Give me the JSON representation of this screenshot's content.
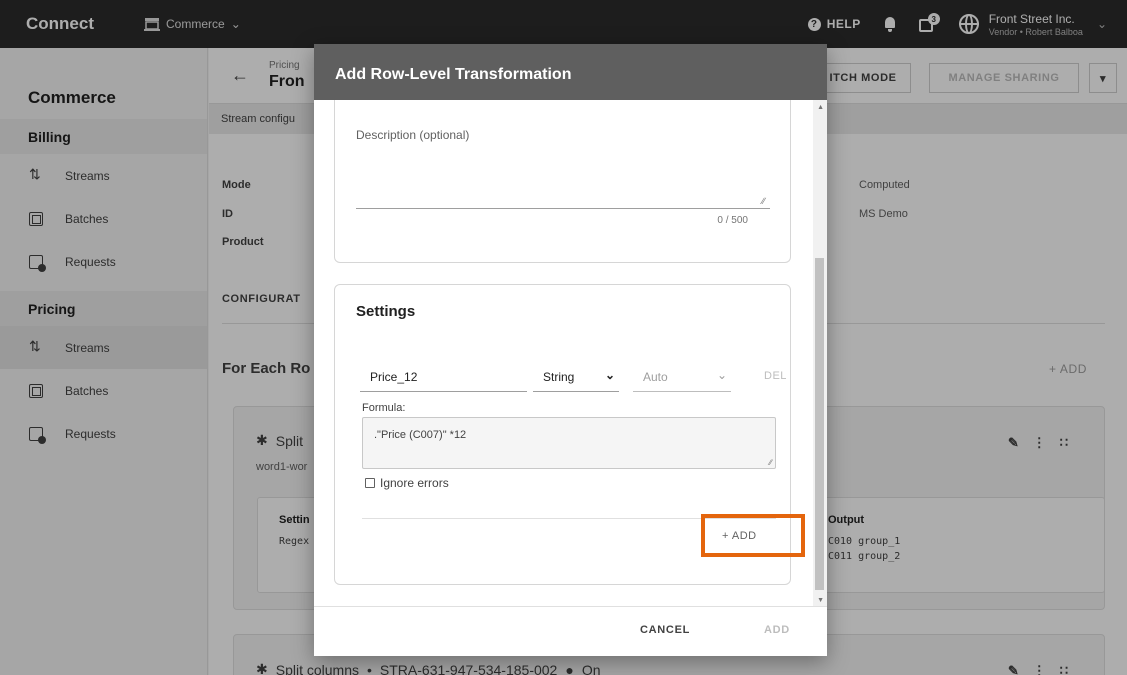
{
  "topbar": {
    "brand": "Connect",
    "module": "Commerce",
    "help": "HELP",
    "notif_count": "3",
    "account_name": "Front Street Inc.",
    "account_sub": "Vendor • Robert Balboa"
  },
  "sidebar": {
    "title": "Commerce",
    "sections": [
      {
        "label": "Billing",
        "items": [
          {
            "label": "Streams",
            "icon": "streams-icon"
          },
          {
            "label": "Batches",
            "icon": "batches-icon"
          },
          {
            "label": "Requests",
            "icon": "requests-icon"
          }
        ]
      },
      {
        "label": "Pricing",
        "items": [
          {
            "label": "Streams",
            "icon": "streams-icon",
            "active": true
          },
          {
            "label": "Batches",
            "icon": "batches-icon"
          },
          {
            "label": "Requests",
            "icon": "requests-icon"
          }
        ]
      }
    ]
  },
  "main": {
    "crumb_small": "Pricing",
    "crumb_big": "Fron",
    "switch_mode": "ITCH MODE",
    "manage_sharing": "MANAGE SHARING",
    "stream_config": "Stream configu",
    "fields": {
      "mode_k": "Mode",
      "id_k": "ID",
      "product_k": "Product",
      "mode_v": "Computed",
      "id_v": "MS Demo"
    },
    "configuration": "CONFIGURAT",
    "for_each": "For Each Ro",
    "add": "+ ADD",
    "card1": {
      "title": "Split",
      "sub": "word1-wor",
      "settings_label": "Settin",
      "regex": "Regex",
      "output_label": "Output",
      "output_rows": [
        "C010  group_1",
        "C011  group_2"
      ]
    },
    "card2": {
      "title": "Split columns",
      "id": "STRA-631-947-534-185-002",
      "status": "On"
    }
  },
  "dialog": {
    "title": "Add Row-Level Transformation",
    "description_label": "Description (optional)",
    "description_count": "0 / 500",
    "settings_title": "Settings",
    "column_name": "Price_12",
    "column_type": "String",
    "column_precision": "Auto",
    "delete_label": "DEL",
    "formula_label": "Formula:",
    "formula_value": ".\"Price (C007)\" *12",
    "ignore_errors": "Ignore errors",
    "inner_add": "+ ADD",
    "cancel": "CANCEL",
    "add": "ADD"
  },
  "colors": {
    "highlight": "#e4650d",
    "topbar": "#2c2c2c",
    "dialog_header": "#5f5f5f"
  }
}
